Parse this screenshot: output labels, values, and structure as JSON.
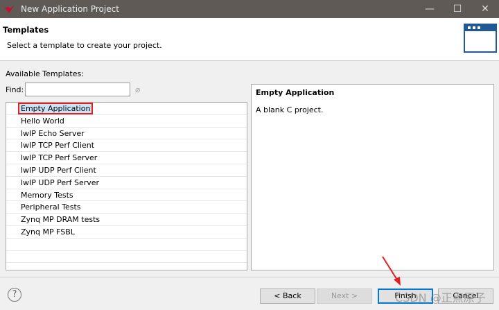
{
  "window": {
    "title": "New Application Project"
  },
  "header": {
    "title": "Templates",
    "subtitle": "Select a template to create your project."
  },
  "templates": {
    "label": "Available Templates:",
    "find_label": "Find:",
    "find_value": "",
    "items": [
      "Empty Application",
      "Hello World",
      "lwIP Echo Server",
      "lwIP TCP Perf Client",
      "lwIP TCP Perf Server",
      "lwIP UDP Perf Client",
      "lwIP UDP Perf Server",
      "Memory Tests",
      "Peripheral Tests",
      "Zynq MP DRAM tests",
      "Zynq MP FSBL"
    ],
    "selected": "Empty Application"
  },
  "description": {
    "title": "Empty Application",
    "text": "A blank C project."
  },
  "buttons": {
    "back": "< Back",
    "next": "Next >",
    "finish": "Finish",
    "cancel": "Cancel"
  },
  "watermark": "CSDN @正点原子",
  "colors": {
    "titlebar": "#5f5a56",
    "selection": "#cce4f7",
    "highlight": "#e02020",
    "accent": "#0078d7"
  }
}
